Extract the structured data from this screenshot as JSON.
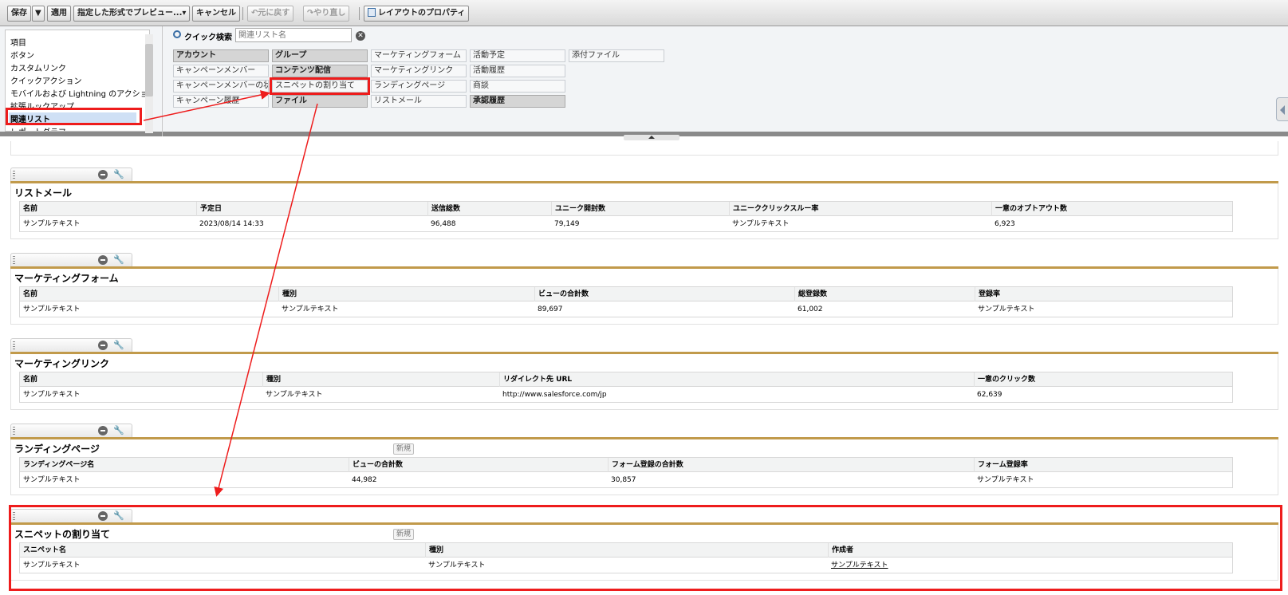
{
  "toolbar": {
    "save": "保存",
    "save_dropdown": "▼",
    "apply": "適用",
    "preview": "指定した形式でプレビュー...▾",
    "cancel": "キャンセル",
    "undo": "元に戻す",
    "redo": "やり直し",
    "layout_properties": "レイアウトのプロパティ"
  },
  "palette": {
    "categories": [
      "項目",
      "ボタン",
      "カスタムリンク",
      "クイックアクション",
      "モバイルおよび Lightning のアクション",
      "拡張ルックアップ",
      "関連リスト",
      "レポートグラフ"
    ],
    "quick_search_label": "クイック検索",
    "quick_search_placeholder": "関連リスト名",
    "items": [
      {
        "label": "アカウント",
        "used": true
      },
      {
        "label": "グループ",
        "used": true
      },
      {
        "label": "マーケティングフォーム",
        "used": false
      },
      {
        "label": "活動予定",
        "used": false
      },
      {
        "label": "添付ファイル",
        "used": false
      },
      {
        "label": "キャンペーンメンバー",
        "used": false
      },
      {
        "label": "コンテンツ配信",
        "used": true
      },
      {
        "label": "マーケティングリンク",
        "used": false
      },
      {
        "label": "活動履歴",
        "used": false
      },
      {
        "label": "キャンペーンメンバーの状況",
        "used": false
      },
      {
        "label": "スニペットの割り当て",
        "used": false
      },
      {
        "label": "ランディングページ",
        "used": false
      },
      {
        "label": "商談",
        "used": false
      },
      {
        "label": "キャンペーン履歴",
        "used": false
      },
      {
        "label": "ファイル",
        "used": true
      },
      {
        "label": "リストメール",
        "used": false
      },
      {
        "label": "承認履歴",
        "used": true
      }
    ]
  },
  "related_lists": [
    {
      "title": "リストメール",
      "new_button": "",
      "headers": [
        "名前",
        "予定日",
        "送信総数",
        "ユニーク開封数",
        "ユニーククリックスルー率",
        "一意のオプトアウト数"
      ],
      "row": [
        "サンプルテキスト",
        "2023/08/14 14:33",
        "96,488",
        "79,149",
        "サンプルテキスト",
        "6,923"
      ]
    },
    {
      "title": "マーケティングフォーム",
      "new_button": "",
      "headers": [
        "名前",
        "種別",
        "ビューの合計数",
        "総登録数",
        "登録率"
      ],
      "row": [
        "サンプルテキスト",
        "サンプルテキスト",
        "89,697",
        "61,002",
        "サンプルテキスト"
      ]
    },
    {
      "title": "マーケティングリンク",
      "new_button": "",
      "headers": [
        "名前",
        "種別",
        "リダイレクト先 URL",
        "一意のクリック数"
      ],
      "row": [
        "サンプルテキスト",
        "サンプルテキスト",
        "http://www.salesforce.com/jp",
        "62,639"
      ]
    },
    {
      "title": "ランディングページ",
      "new_button": "新規",
      "headers": [
        "ランディングページ名",
        "ビューの合計数",
        "フォーム登録の合計数",
        "フォーム登録率"
      ],
      "row": [
        "サンプルテキスト",
        "44,982",
        "30,857",
        "サンプルテキスト"
      ]
    },
    {
      "title": "スニペットの割り当て",
      "new_button": "新規",
      "headers": [
        "スニペット名",
        "種別",
        "作成者"
      ],
      "row": [
        "サンプルテキスト",
        "サンプルテキスト",
        "サンプルテキスト"
      ]
    }
  ],
  "colors": {
    "highlight": "#ee1c1c",
    "section_bar": "#c19a4b"
  }
}
